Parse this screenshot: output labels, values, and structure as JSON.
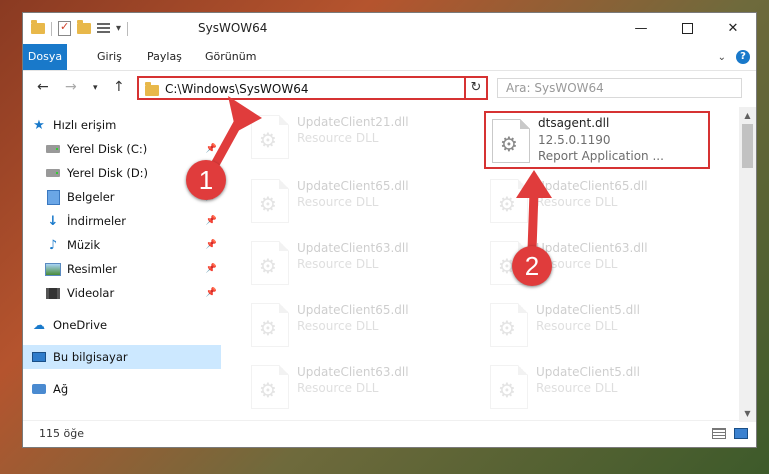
{
  "window": {
    "title": "SysWOW64",
    "controls": {
      "minimize": "—",
      "close": "✕"
    }
  },
  "ribbon": {
    "tabs": [
      {
        "label": "Dosya"
      },
      {
        "label": "Giriş"
      },
      {
        "label": "Paylaş"
      },
      {
        "label": "Görünüm"
      }
    ],
    "help": "?"
  },
  "address": {
    "path": "C:\\Windows\\SysWOW64",
    "search_placeholder": "Ara: SysWOW64"
  },
  "sidebar": {
    "items": [
      {
        "label": "Hızlı erişim",
        "icon": "star-icon"
      },
      {
        "label": "Yerel Disk (C:)",
        "icon": "disk-icon"
      },
      {
        "label": "Yerel Disk (D:)",
        "icon": "disk-icon"
      },
      {
        "label": "Belgeler",
        "icon": "documents-icon"
      },
      {
        "label": "İndirmeler",
        "icon": "download-icon"
      },
      {
        "label": "Müzik",
        "icon": "music-icon"
      },
      {
        "label": "Resimler",
        "icon": "pictures-icon"
      },
      {
        "label": "Videolar",
        "icon": "videos-icon"
      },
      {
        "label": "OneDrive",
        "icon": "cloud-icon"
      },
      {
        "label": "Bu bilgisayar",
        "icon": "computer-icon"
      },
      {
        "label": "Ağ",
        "icon": "network-icon"
      }
    ]
  },
  "files": [
    {
      "name": "UpdateClient21.dll",
      "type": "Resource DLL"
    },
    {
      "name": "dtsagent.dll",
      "version": "12.5.0.1190",
      "type": "Report Application ..."
    },
    {
      "name": "UpdateClient65.dll",
      "type": "Resource DLL"
    },
    {
      "name": "UpdateClient65.dll",
      "type": "Resource DLL"
    },
    {
      "name": "UpdateClient63.dll",
      "type": "Resource DLL"
    },
    {
      "name": "UpdateClient63.dll",
      "type": "Resource DLL"
    },
    {
      "name": "UpdateClient65.dll",
      "type": "Resource DLL"
    },
    {
      "name": "UpdateClient5.dll",
      "type": "Resource DLL"
    },
    {
      "name": "UpdateClient63.dll",
      "type": "Resource DLL"
    },
    {
      "name": "UpdateClient5.dll",
      "type": "Resource DLL"
    }
  ],
  "status": {
    "count": "115 öğe"
  },
  "annotations": {
    "marker1": "1",
    "marker2": "2",
    "color": "#e03c3c"
  }
}
